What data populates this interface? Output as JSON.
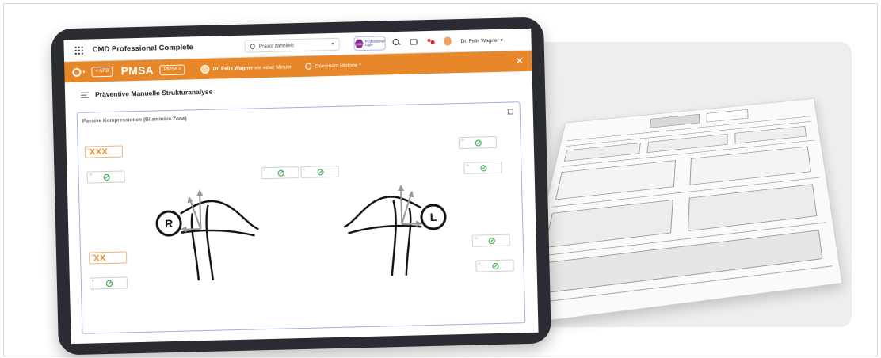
{
  "app": {
    "title": "CMD Professional Complete",
    "practice_placeholder": "Praxis zahnlieb",
    "logo_text_1": "CMD",
    "logo_text_2": "Professional",
    "logo_text_3": "Light",
    "user_name": "Dr. Felix Wagner"
  },
  "module_bar": {
    "arb_label": "< ARB",
    "module_title": "PMSA",
    "next_label": "PMSA >",
    "author": "Dr. Felix Wagner",
    "author_time": "vor einer Minute",
    "history_label": "Dokument Historie"
  },
  "section": {
    "title": "Präventive Manuelle Strukturanalyse"
  },
  "panel": {
    "title": "Passive Kompressionen (Bilaminäre Zone)"
  },
  "fields": {
    "mark_xxx": "XXX",
    "mark_xx": "XX"
  },
  "sides": {
    "right": "R",
    "left": "L"
  },
  "colors": {
    "accent": "#e8862a",
    "ok": "#2fa54a",
    "panel_border": "#9fb2d8"
  }
}
